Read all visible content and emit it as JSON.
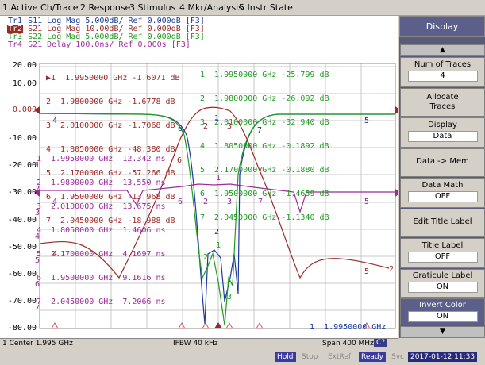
{
  "menu": [
    "1 Active Ch/Trace",
    "2 Response",
    "3 Stimulus",
    "4 Mkr/Analysis",
    "5 Instr State"
  ],
  "traces": [
    {
      "name": "Tr1",
      "rest": " S11 Log Mag 5.000dB/ Ref 0.000dB [F3]",
      "color": "#1a3a9a"
    },
    {
      "name": "Tr2",
      "rest": " S21 Log Mag 10.00dB/ Ref 0.000dB [F3]",
      "color": "#9b2828",
      "selected": true
    },
    {
      "name": "Tr3",
      "rest": " S22 Log Mag 5.000dB/ Ref 0.000dB [F3]",
      "color": "#1f9b1f"
    },
    {
      "name": "Tr4",
      "rest": " S21 Delay 100.0ns/ Ref 0.000s [F3]",
      "color": "#9b2a9b"
    }
  ],
  "y_axis_labels": [
    "20.00",
    "10.00",
    "0.000",
    "-10.00",
    "-20.00",
    "-30.00",
    "-40.00",
    "-50.00",
    "-60.00",
    "-70.00",
    "-80.00"
  ],
  "markers_tr2": [
    "▶1  1.9950000 GHz -1.6071 dB",
    "2  1.9800000 GHz -1.6778 dB",
    "3  2.0100000 GHz -1.7068 dB",
    "4  1.8050000 GHz -48.380 dB",
    "5  2.1700000 GHz -57.266 dB",
    "6  1.9500000 GHz -13.968 dB",
    "7  2.0450000 GHz -18.988 dB"
  ],
  "markers_tr3": [
    "1  1.9950000 GHz -25.799 dB",
    "2  1.9800000 GHz -26.092 dB",
    "3  2.0100000 GHz -32.940 dB",
    "4  1.8050000 GHz -0.1892 dB",
    "5  2.1700000 GHz -0.1880 dB",
    "6  1.9500000 GHz -1.4659 dB",
    "7  2.0450000 GHz -1.1340 dB"
  ],
  "markers_tr4": [
    "1  1.9950000 GHz  12.342 ns",
    "2  1.9800000 GHz  13.550 ns",
    "3  2.0100000 GHz  13.675 ns",
    "4  1.8050000 GHz  1.4606 ns",
    "5  2.1700000 GHz  4.1697 ns",
    "6  1.9500000 GHz  9.1616 ns",
    "7  2.0450000 GHz  7.2066 ns"
  ],
  "marker_nums_left": [
    "1",
    "2",
    "3",
    "4",
    "5",
    "6",
    "7"
  ],
  "marker_bottom": "1  1.9950000 GHz",
  "status": {
    "center": "1  Center 1.995 GHz",
    "ifbw": "IFBW 40 kHz",
    "span": "Span 400 MHz",
    "cal": "C?"
  },
  "bottom": {
    "hold": "Hold",
    "stop": "Stop",
    "extref": "ExtRef",
    "ready": "Ready",
    "svc": "Svc",
    "datetime": "2017-01-12 11:33"
  },
  "softkeys": {
    "title": "Display",
    "num_traces": "Num of Traces",
    "num_traces_val": "4",
    "allocate": "Allocate",
    "allocate2": "Traces",
    "display": "Display",
    "display_val": "Data",
    "data_mem": "Data -> Mem",
    "data_math": "Data Math",
    "data_math_val": "OFF",
    "edit_title": "Edit Title Label",
    "title_label": "Title Label",
    "title_label_val": "OFF",
    "graticule": "Graticule Label",
    "graticule_val": "ON",
    "invert": "Invert Color",
    "invert_val": "ON"
  },
  "trace_marker_labels": {
    "tr1": [
      "4",
      "6",
      "2",
      "1",
      "3",
      "7",
      "5"
    ],
    "tr2": [
      "1",
      "2",
      "3",
      "4",
      "5",
      "6",
      "7"
    ],
    "tr3": [
      "1",
      "2",
      "3",
      "4",
      "5",
      "6",
      "7"
    ],
    "tr4": [
      "1",
      "2",
      "3",
      "4",
      "5",
      "6",
      "7"
    ],
    "ref_right": "2"
  }
}
